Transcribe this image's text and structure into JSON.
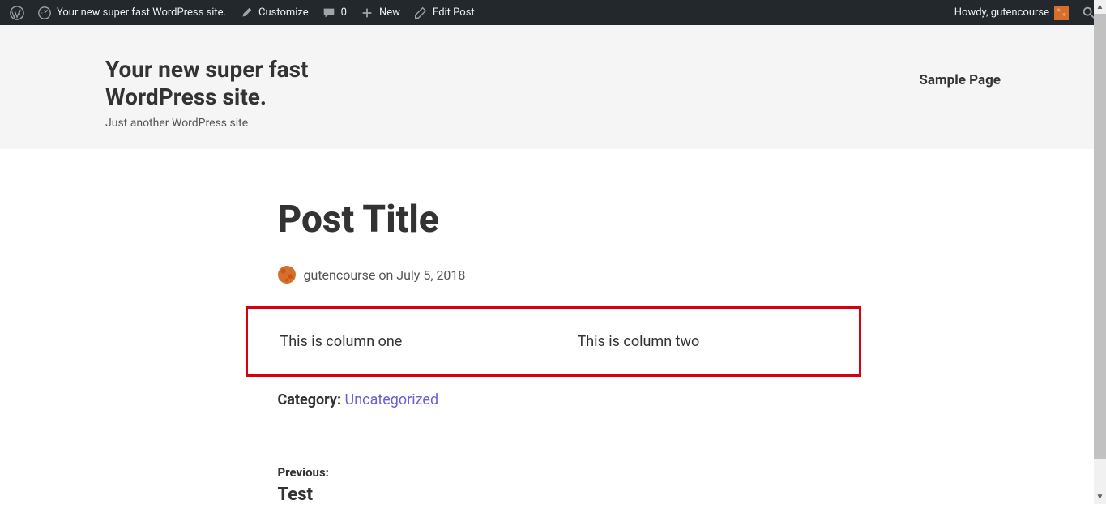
{
  "admin_bar": {
    "site_name": "Your new super fast WordPress site.",
    "customize": "Customize",
    "comments_count": "0",
    "new": "New",
    "edit_post": "Edit Post",
    "howdy": "Howdy, gutencourse"
  },
  "header": {
    "site_title": "Your new super fast WordPress site.",
    "tagline": "Just another WordPress site",
    "nav_item": "Sample Page"
  },
  "post": {
    "title": "Post Title",
    "author": "gutencourse",
    "meta_connector": "on",
    "date": "July 5, 2018",
    "column_one": "This is column one",
    "column_two": "This is column two",
    "category_label": "Category:",
    "category_value": "Uncategorized",
    "prev_label": "Previous:",
    "prev_title": "Test"
  }
}
